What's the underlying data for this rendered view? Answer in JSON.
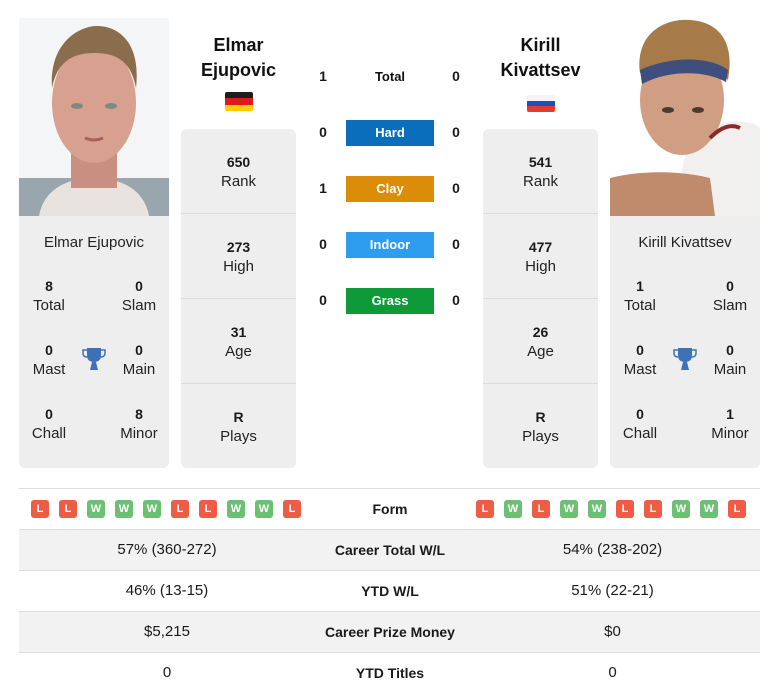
{
  "colors": {
    "hard": "#0a6ebd",
    "clay": "#db8c08",
    "indoor": "#2e9df0",
    "grass": "#0f9a3a",
    "win": "#6cbf73",
    "loss": "#ee5c45",
    "trophy": "#3d72b8",
    "panel": "#eeeeee"
  },
  "player1": {
    "name_line1": "Elmar",
    "name_line2": "Ejupovic",
    "full_name": "Elmar Ejupovic",
    "flag": "germany",
    "titles": {
      "total": {
        "value": "8",
        "label": "Total"
      },
      "slam": {
        "value": "0",
        "label": "Slam"
      },
      "mast": {
        "value": "0",
        "label": "Mast"
      },
      "main": {
        "value": "0",
        "label": "Main"
      },
      "chall": {
        "value": "0",
        "label": "Chall"
      },
      "minor": {
        "value": "8",
        "label": "Minor"
      }
    },
    "stats": [
      {
        "value": "650",
        "label": "Rank"
      },
      {
        "value": "273",
        "label": "High"
      },
      {
        "value": "31",
        "label": "Age"
      },
      {
        "value": "R",
        "label": "Plays"
      }
    ],
    "form": [
      "L",
      "L",
      "W",
      "W",
      "W",
      "L",
      "L",
      "W",
      "W",
      "L"
    ]
  },
  "player2": {
    "name_line1": "Kirill",
    "name_line2": "Kivattsev",
    "full_name": "Kirill Kivattsev",
    "flag": "russia",
    "titles": {
      "total": {
        "value": "1",
        "label": "Total"
      },
      "slam": {
        "value": "0",
        "label": "Slam"
      },
      "mast": {
        "value": "0",
        "label": "Mast"
      },
      "main": {
        "value": "0",
        "label": "Main"
      },
      "chall": {
        "value": "0",
        "label": "Chall"
      },
      "minor": {
        "value": "1",
        "label": "Minor"
      }
    },
    "stats": [
      {
        "value": "541",
        "label": "Rank"
      },
      {
        "value": "477",
        "label": "High"
      },
      {
        "value": "26",
        "label": "Age"
      },
      {
        "value": "R",
        "label": "Plays"
      }
    ],
    "form": [
      "L",
      "W",
      "L",
      "W",
      "W",
      "L",
      "L",
      "W",
      "W",
      "L"
    ]
  },
  "h2h": [
    {
      "label": "Total",
      "p1": "1",
      "p2": "0",
      "surface": "total"
    },
    {
      "label": "Hard",
      "p1": "0",
      "p2": "0",
      "surface": "hard"
    },
    {
      "label": "Clay",
      "p1": "1",
      "p2": "0",
      "surface": "clay"
    },
    {
      "label": "Indoor",
      "p1": "0",
      "p2": "0",
      "surface": "indoor"
    },
    {
      "label": "Grass",
      "p1": "0",
      "p2": "0",
      "surface": "grass"
    }
  ],
  "comparison": {
    "form_label": "Form",
    "rows": [
      {
        "label": "Career Total W/L",
        "p1": "57% (360-272)",
        "p2": "54% (238-202)"
      },
      {
        "label": "YTD W/L",
        "p1": "46% (13-15)",
        "p2": "51% (22-21)"
      },
      {
        "label": "Career Prize Money",
        "p1": "$5,215",
        "p2": "$0"
      },
      {
        "label": "YTD Titles",
        "p1": "0",
        "p2": "0"
      }
    ]
  }
}
